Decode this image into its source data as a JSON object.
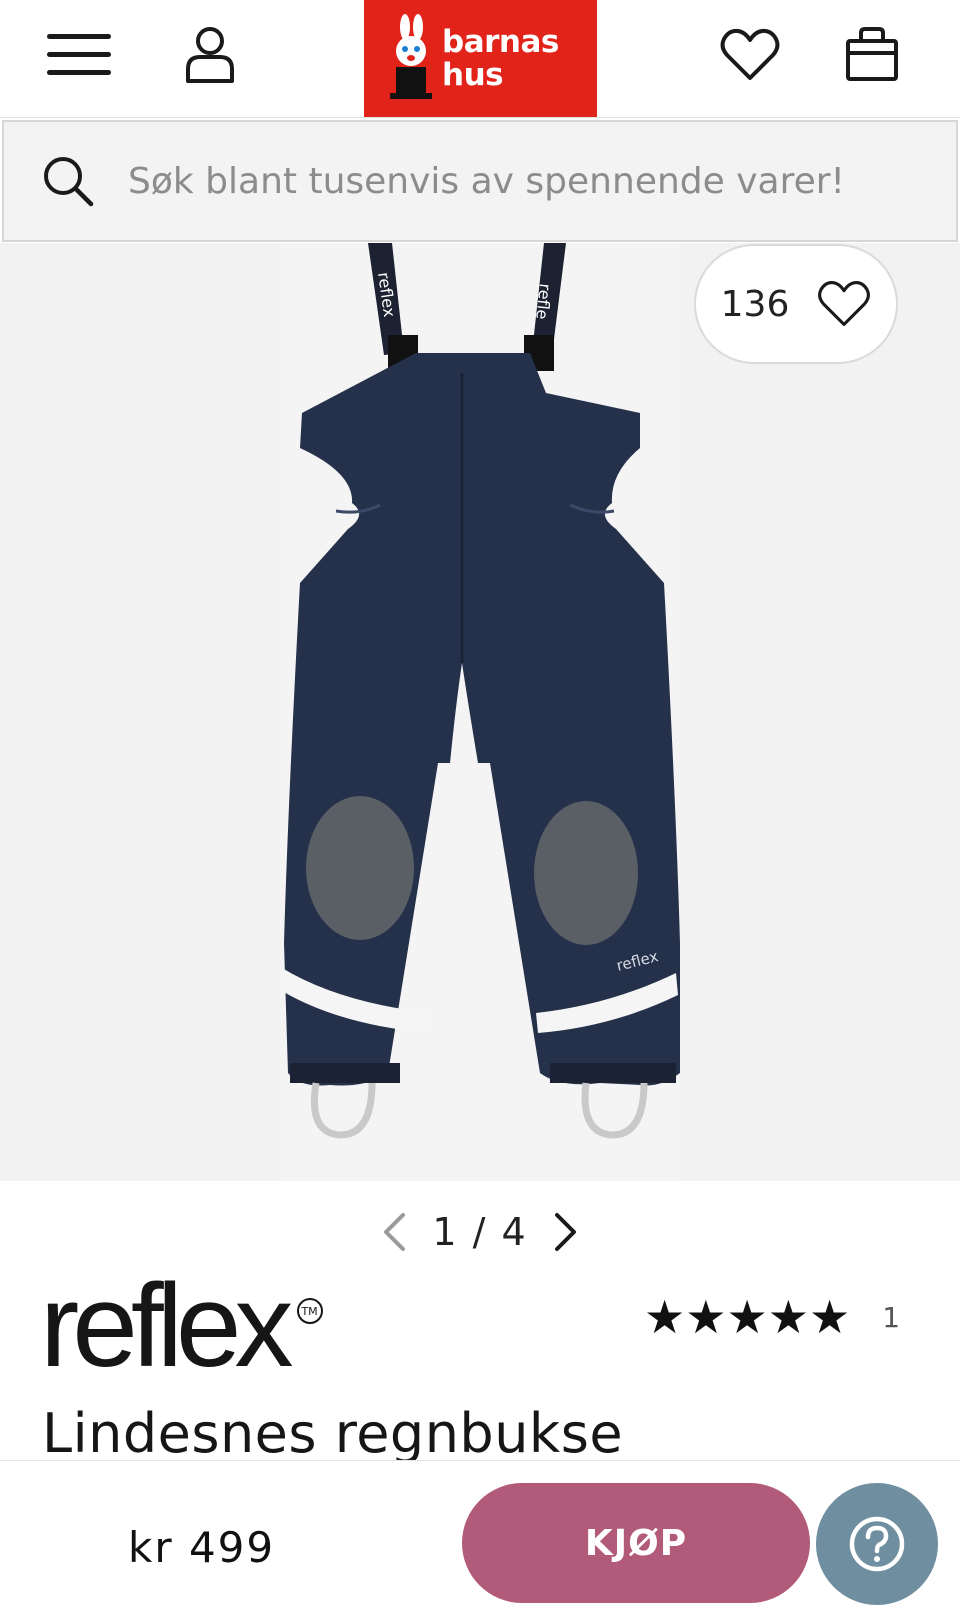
{
  "header": {
    "logo_line1": "barnas",
    "logo_line2": "hus",
    "icons": [
      "menu-icon",
      "user-icon",
      "heart-icon",
      "shopping-bag-icon"
    ],
    "brand_color": "#e2231a"
  },
  "search": {
    "placeholder": "Søk blant tusenvis av spennende varer!"
  },
  "gallery": {
    "favorite_count": "136",
    "pager_text": "1 / 4"
  },
  "product": {
    "brand": "reflex",
    "trademark": "TM",
    "stars": "★★★★★",
    "rating_value": 5,
    "rating_count": "1",
    "title": "Lindesnes regnbukse"
  },
  "bottom_bar": {
    "price": "kr 499",
    "buy_label": "KJØP",
    "buy_color": "#b15a79",
    "help_color": "#6f8fa0"
  }
}
